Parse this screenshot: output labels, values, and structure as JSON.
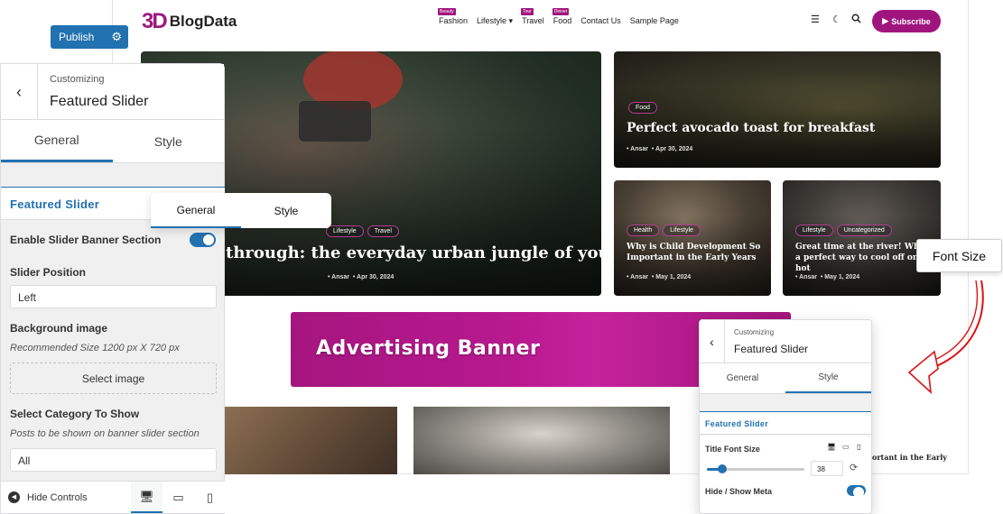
{
  "publish": {
    "label": "Publish"
  },
  "site": {
    "logo_mark": "3D",
    "logo_text": "BlogData",
    "nav": [
      {
        "label": "Fashion",
        "badge": "Beauty"
      },
      {
        "label": "Lifestyle ▾",
        "badge": ""
      },
      {
        "label": "Travel",
        "badge": "Tour"
      },
      {
        "label": "Food",
        "badge": "Dinner"
      },
      {
        "label": "Contact Us",
        "badge": ""
      },
      {
        "label": "Sample Page",
        "badge": ""
      }
    ],
    "subscribe_label": "Subscribe",
    "featured": {
      "chips": [
        "Lifestyle",
        "Travel"
      ],
      "title": "through: the everyday urban jungle of your city",
      "author": "Ansar",
      "date": "Apr 30, 2024"
    },
    "food_post": {
      "chip": "Food",
      "title": "Perfect avocado toast for breakfast",
      "author": "Ansar",
      "date": "Apr 30, 2024"
    },
    "child_post": {
      "chips": [
        "Health",
        "Lifestyle"
      ],
      "title": "Why is Child Development So Important in the Early Years",
      "author": "Ansar",
      "date": "May 1, 2024"
    },
    "river_post": {
      "chips": [
        "Lifestyle",
        "Uncategorized"
      ],
      "title": "Great time at the river! What a perfect way to cool off on a hot",
      "author": "Ansar",
      "date": "May 1, 2024"
    },
    "ad_text": "Advertising Banner",
    "partial_text": "ortant in the Early"
  },
  "panel": {
    "crumb": "Customizing",
    "title": "Featured Slider",
    "tabs": [
      "General",
      "Style"
    ],
    "section": "Featured Slider",
    "enable_label": "Enable Slider Banner Section",
    "position_label": "Slider Position",
    "position_value": "Left",
    "bg_label": "Background image",
    "bg_desc": "Recommended Size 1200 px X 720 px",
    "select_image": "Select image",
    "category_label": "Select Category To Show",
    "category_desc": "Posts to be shown on banner slider section",
    "category_value": "All",
    "hide_controls": "Hide Controls"
  },
  "float_tabs": [
    "General",
    "Style"
  ],
  "callout": "Font Size",
  "mini": {
    "crumb": "Customizing",
    "title": "Featured Slider",
    "tabs": [
      "General",
      "Style"
    ],
    "section": "Featured Slider",
    "font_size_label": "Title Font Size",
    "font_size_value": "38",
    "meta_label": "Hide / Show Meta"
  }
}
